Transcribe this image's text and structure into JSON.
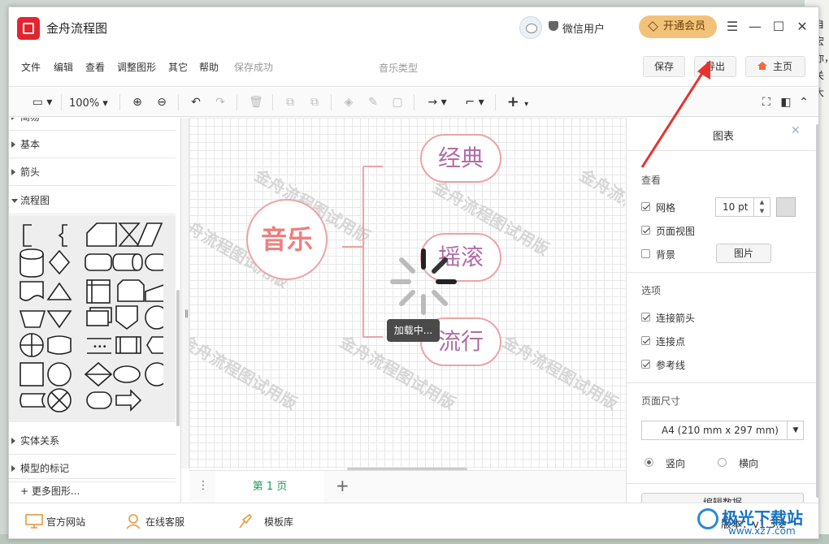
{
  "desktop": {
    "side_text": "自宏你，关大"
  },
  "titlebar": {
    "app_title": "金舟流程图",
    "user_name": "微信用户",
    "vip_label": "开通会员",
    "menu_icon": "hamburger-icon",
    "minimize_icon": "minimize-icon",
    "maximize_icon": "maximize-icon",
    "close_icon": "close-icon"
  },
  "menubar": {
    "items": [
      "文件",
      "编辑",
      "查看",
      "调整图形",
      "其它",
      "帮助"
    ],
    "save_status": "保存成功",
    "doc_title": "音乐类型",
    "save_label": "保存",
    "export_label": "导出",
    "home_label": "主页"
  },
  "toolbar": {
    "zoom": "100%"
  },
  "left_panel": {
    "categories": [
      "简易",
      "基本",
      "箭头",
      "流程图",
      "实体关系",
      "模型的标记"
    ],
    "more_shapes": "+ 更多图形..."
  },
  "canvas": {
    "watermark": "金舟流程图试用版",
    "center_node": "音乐",
    "child_nodes": [
      "经典",
      "摇滚",
      "流行"
    ],
    "loading_text": "加载中..."
  },
  "pagebar": {
    "page_tab": "第 1 页"
  },
  "right_panel": {
    "title": "图表",
    "view_heading": "查看",
    "grid_label": "网格",
    "grid_size": "10 pt",
    "page_view_label": "页面视图",
    "background_label": "背景",
    "image_button": "图片",
    "options_heading": "选项",
    "connect_arrows_label": "连接箭头",
    "connect_points_label": "连接点",
    "guides_label": "参考线",
    "paper_heading": "页面尺寸",
    "paper_size": "A4 (210 mm x 297 mm)",
    "portrait_label": "竖向",
    "landscape_label": "横向",
    "edit_data_button": "编辑数据"
  },
  "footer": {
    "website": "官方网站",
    "support": "在线客服",
    "templates": "模板库",
    "version": "版本：v1.3.2"
  },
  "overlay": {
    "site_name": "极光下载站",
    "site_url": "www.xz7.com",
    "arrow_color": "#e8322f"
  }
}
